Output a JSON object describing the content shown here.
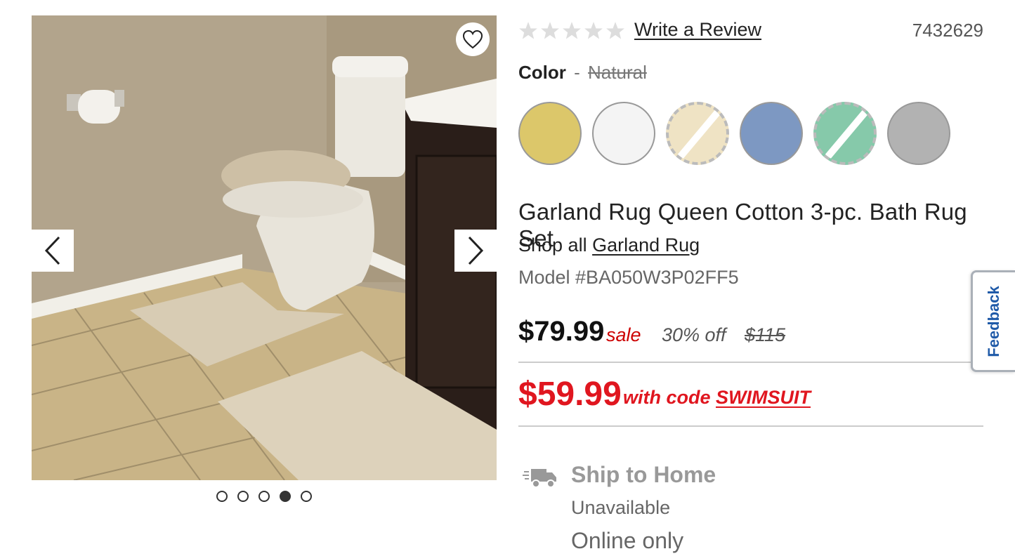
{
  "gallery": {
    "favorite_icon": "heart-outline-icon",
    "prev_icon": "chevron-left-icon",
    "next_icon": "chevron-right-icon",
    "slide_count": 5,
    "active_slide": 4
  },
  "product": {
    "review_link": "Write a Review",
    "rating": 0,
    "rating_max": 5,
    "sku": "7432629",
    "color_label": "Color",
    "color_separator": "-",
    "color_value": "Natural",
    "swatches": [
      {
        "color": "#dcc76a",
        "available": true
      },
      {
        "color": "#f4f4f4",
        "available": true
      },
      {
        "color": "#efe3c4",
        "available": false
      },
      {
        "color": "#7d98c2",
        "available": true
      },
      {
        "color": "#86c9aa",
        "available": false
      },
      {
        "color": "#b2b2b2",
        "available": true
      }
    ],
    "title": "Garland Rug Queen Cotton 3-pc. Bath Rug Set",
    "shop_all_prefix": "Shop all",
    "brand": "Garland Rug",
    "model": "Model #BA050W3P02FF5"
  },
  "pricing": {
    "current": "$79.99",
    "sale_label": "sale",
    "discount": "30% off",
    "original": "$115",
    "code_price": "$59.99",
    "code_prefix": "with code",
    "code": "SWIMSUIT"
  },
  "shipping": {
    "icon": "delivery-truck-icon",
    "title": "Ship to Home",
    "status": "Unavailable",
    "note": "Online only"
  },
  "feedback": {
    "label": "Feedback"
  },
  "colors": {
    "accent_red": "#e0161f",
    "feedback_blue": "#1f5aa8",
    "star_empty": "#dddddd"
  }
}
